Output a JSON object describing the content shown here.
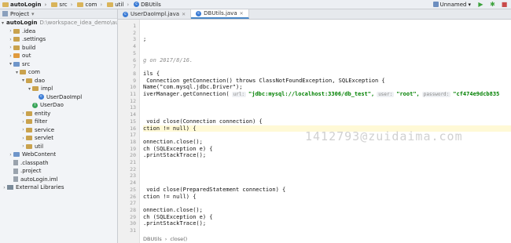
{
  "breadcrumbs": [
    {
      "label": "autoLogin",
      "icon": "folder-icon",
      "bold": true
    },
    {
      "label": "src",
      "icon": "folder-icon",
      "bold": false
    },
    {
      "label": "com",
      "icon": "folder-icon",
      "bold": false
    },
    {
      "label": "util",
      "icon": "folder-icon",
      "bold": false
    },
    {
      "label": "DBUtils",
      "icon": "class-icon",
      "bold": false
    }
  ],
  "toolbar": {
    "run_config": "Unnamed"
  },
  "project_panel": {
    "title": "Project",
    "tree": [
      {
        "label": "autoLogin",
        "path": "D:\\workspace_idea_demo\\autoLo",
        "arrow": "▾",
        "icon": "folder",
        "depth": 0,
        "bold": true
      },
      {
        "label": ".idea",
        "arrow": "›",
        "icon": "folder",
        "depth": 1
      },
      {
        "label": ".settings",
        "arrow": "›",
        "icon": "folder",
        "depth": 1
      },
      {
        "label": "build",
        "arrow": "›",
        "icon": "folder",
        "depth": 1
      },
      {
        "label": "out",
        "arrow": "›",
        "icon": "folder-orange",
        "depth": 1
      },
      {
        "label": "src",
        "arrow": "▾",
        "icon": "folder-blue",
        "depth": 1
      },
      {
        "label": "com",
        "arrow": "▾",
        "icon": "folder",
        "depth": 2
      },
      {
        "label": "dao",
        "arrow": "▾",
        "icon": "folder",
        "depth": 3
      },
      {
        "label": "impl",
        "arrow": "▾",
        "icon": "folder",
        "depth": 4
      },
      {
        "label": "UserDaoImpl",
        "arrow": "",
        "icon": "class",
        "depth": 5
      },
      {
        "label": "UserDao",
        "arrow": "",
        "icon": "interface",
        "depth": 4
      },
      {
        "label": "entity",
        "arrow": "›",
        "icon": "folder",
        "depth": 3
      },
      {
        "label": "filter",
        "arrow": "›",
        "icon": "folder",
        "depth": 3
      },
      {
        "label": "service",
        "arrow": "›",
        "icon": "folder",
        "depth": 3
      },
      {
        "label": "servlet",
        "arrow": "›",
        "icon": "folder",
        "depth": 3
      },
      {
        "label": "util",
        "arrow": "›",
        "icon": "folder",
        "depth": 3
      },
      {
        "label": "WebContent",
        "arrow": "›",
        "icon": "folder-blue",
        "depth": 1
      },
      {
        "label": ".classpath",
        "arrow": "",
        "icon": "file",
        "depth": 1
      },
      {
        "label": ".project",
        "arrow": "",
        "icon": "file",
        "depth": 1
      },
      {
        "label": "autoLogin.iml",
        "arrow": "",
        "icon": "file",
        "depth": 1
      },
      {
        "label": "External Libraries",
        "arrow": "›",
        "icon": "library",
        "depth": 0
      }
    ]
  },
  "tabs": [
    {
      "label": "UserDaoImpl.java",
      "active": false
    },
    {
      "label": "DBUtils.java",
      "active": true
    }
  ],
  "editor": {
    "line_numbers": [
      "1",
      "2",
      "3",
      "4",
      "5",
      "6",
      "7",
      "8",
      "9",
      "10",
      "11",
      "12",
      "13",
      "14",
      "15",
      "16",
      "17",
      "18",
      "19",
      "20",
      "21",
      "22",
      "23",
      "24",
      "25",
      "26",
      "27",
      "28",
      "29",
      "30",
      "31"
    ],
    "lines": [
      "",
      "",
      ";",
      "",
      "",
      "g on 2017/8/16.",
      "",
      "ils {",
      " Connection getConnection() throws ClassNotFoundException, SQLException {",
      "Name(\"com.mysql.jdbc.Driver\");",
      "iverManager.getConnection(",
      "",
      "",
      "",
      " void close(Connection connection) {",
      "ction != null) {",
      "",
      "onnection.close();",
      "ch (SQLException e) {",
      ".printStackTrace();",
      "",
      "",
      "",
      "",
      " void close(PreparedStatement connection) {",
      "ction != null) {",
      "",
      "onnection.close();",
      "ch (SQLException e) {",
      ".printStackTrace();",
      ""
    ],
    "conn_hints": {
      "url_hint": "url:",
      "url_value": "\"jdbc:mysql://localhost:3306/db_test\",",
      "user_hint": "user:",
      "user_value": "\"root\",",
      "password_hint": "password:",
      "password_value": "\"cf474e9dcb835"
    },
    "watermark": "1412793@zuidaima.com",
    "status_crumb": [
      "DBUtils",
      "close()"
    ]
  }
}
